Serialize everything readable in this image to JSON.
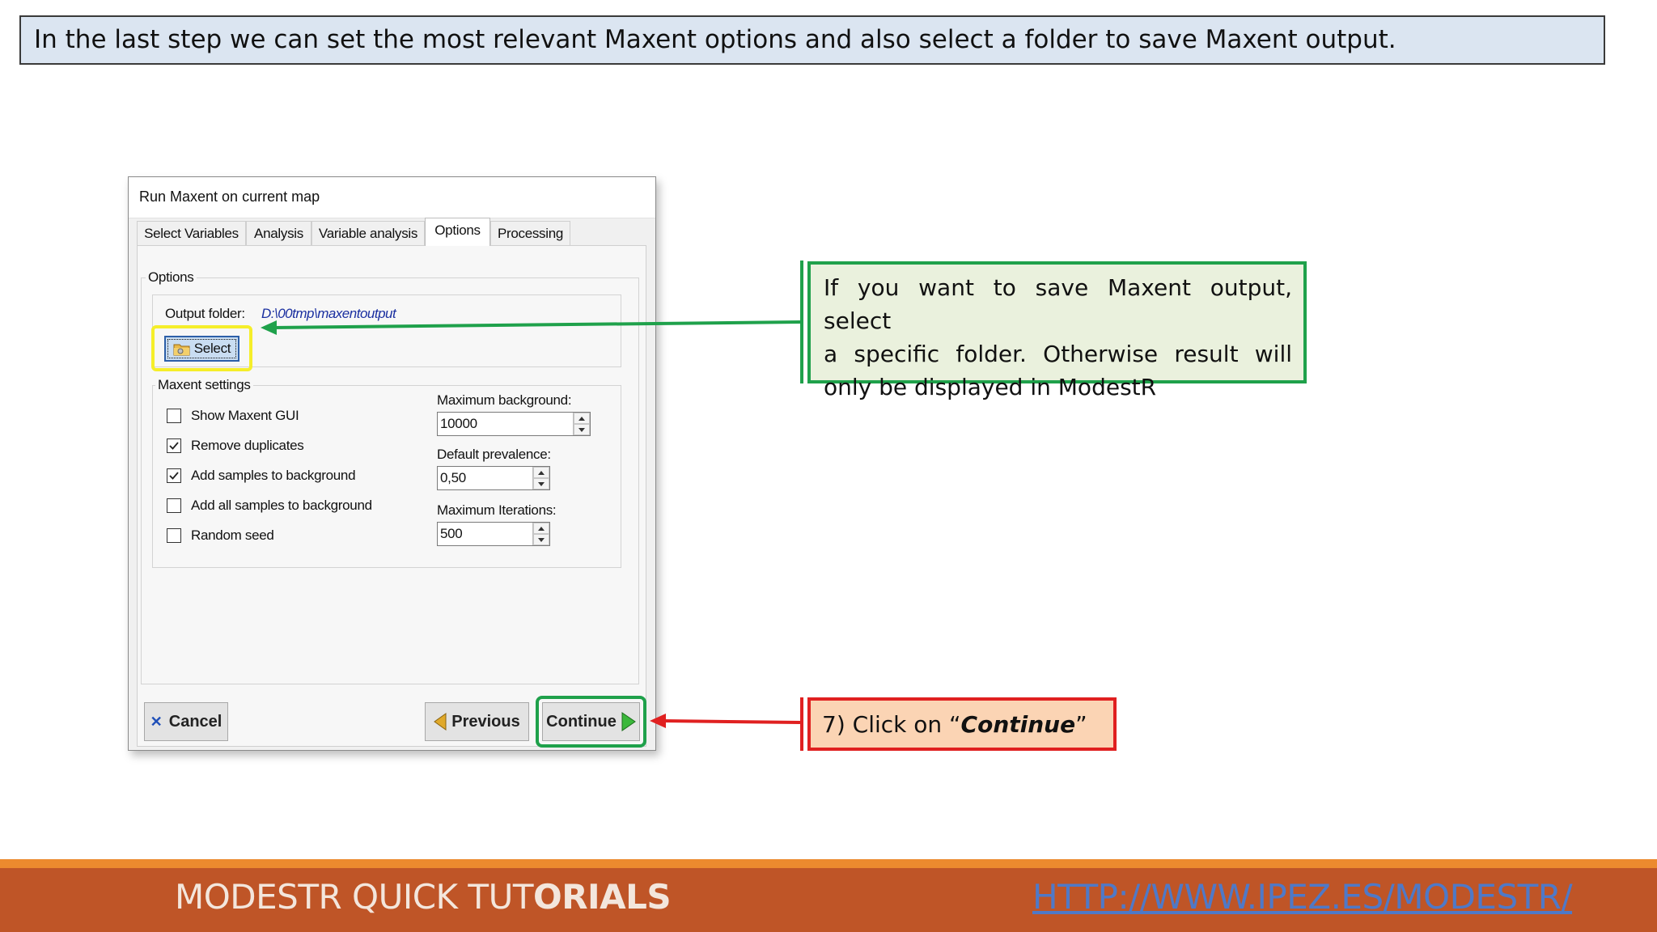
{
  "banner": {
    "text": "In the last step we can set the most relevant Maxent options and also select a folder to save Maxent output."
  },
  "dialog": {
    "title": "Run Maxent on current map",
    "tabs": [
      {
        "label": "Select Variables",
        "active": false
      },
      {
        "label": "Analysis",
        "active": false
      },
      {
        "label": "Variable analysis",
        "active": false
      },
      {
        "label": "Options",
        "active": true
      },
      {
        "label": "Processing",
        "active": false
      }
    ],
    "options_group_label": "Options",
    "output_folder_label": "Output folder:",
    "output_folder_path": "D:\\00tmp\\maxentoutput",
    "select_button_label": "Select",
    "maxent_settings_label": "Maxent settings",
    "checkboxes": [
      {
        "label": "Show Maxent GUI",
        "checked": false
      },
      {
        "label": "Remove duplicates",
        "checked": true
      },
      {
        "label": "Add samples to background",
        "checked": true
      },
      {
        "label": "Add all samples to background",
        "checked": false
      },
      {
        "label": "Random seed",
        "checked": false
      }
    ],
    "max_background": {
      "label": "Maximum background:",
      "value": "10000"
    },
    "default_prevalence": {
      "label": "Default prevalence:",
      "value": "0,50"
    },
    "max_iterations": {
      "label": "Maximum Iterations:",
      "value": "500"
    },
    "buttons": {
      "cancel": "Cancel",
      "previous": "Previous",
      "continue": "Continue"
    }
  },
  "callouts": {
    "select_note": [
      "If you want to save Maxent output, select",
      "a specific folder. Otherwise result will",
      "only be displayed in ModestR"
    ],
    "continue_note_prefix": "7) Click on “",
    "continue_note_emph": "Continue",
    "continue_note_suffix": "”"
  },
  "colors": {
    "highlight_yellow": "#f5ee2a",
    "highlight_green": "#1fa14b",
    "arrow_red": "#e02020",
    "footer_bg": "#bf5527",
    "footer_stripe": "#ec8a2e"
  },
  "footer": {
    "title_normal": "MODESTR QUICK TUT",
    "title_bold": "ORIALS",
    "link": "HTTP://WWW.IPEZ.ES/MODESTR/"
  }
}
